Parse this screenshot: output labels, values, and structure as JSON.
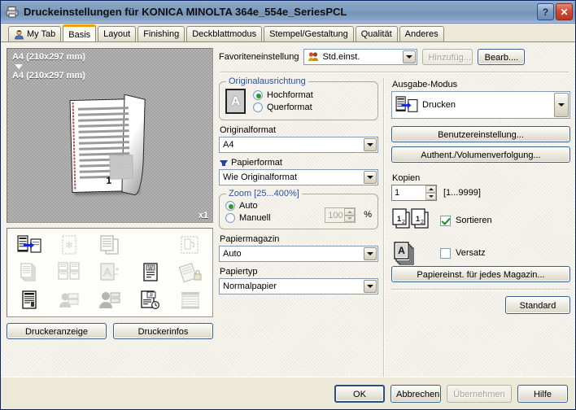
{
  "window": {
    "title": "Druckeinstellungen für KONICA MINOLTA 364e_554e_SeriesPCL",
    "icon": "printer-icon",
    "help_button": "?",
    "close_button": "✕"
  },
  "tabs": [
    {
      "label": "My Tab",
      "icon": "user-icon",
      "active": false
    },
    {
      "label": "Basis",
      "active": true
    },
    {
      "label": "Layout",
      "active": false
    },
    {
      "label": "Finishing",
      "active": false
    },
    {
      "label": "Deckblattmodus",
      "active": false
    },
    {
      "label": "Stempel/Gestaltung",
      "active": false
    },
    {
      "label": "Qualität",
      "active": false
    },
    {
      "label": "Anderes",
      "active": false
    }
  ],
  "preview": {
    "original_size": "A4 (210x297 mm)",
    "paper_size": "A4 (210x297 mm)",
    "zoom_indicator": "x1",
    "page_number": "1"
  },
  "icon_grid": [
    "printer-output-icon",
    "watermark-icon",
    "copy-pages-icon",
    "",
    "booklet-icon",
    "stacked-pages-icon",
    "nup-layout-icon",
    "overlay-a-icon",
    "form-overlay-icon",
    "secure-print-icon",
    "document-chart-icon",
    "user-box-icon",
    "user-auth-icon",
    "timed-print-icon",
    "blinds-icon"
  ],
  "preview_buttons": {
    "printer_display": "Druckeranzeige",
    "printer_info": "Druckerinfos"
  },
  "favorites": {
    "label": "Favoriteneinstellung",
    "value": "Std.einst.",
    "icon": "favorite-setting-icon",
    "add_button": "Hinzufüg....",
    "add_disabled": true,
    "edit_button": "Bearb...."
  },
  "orientation": {
    "group_label": "Originalausrichtung",
    "thumb_letter": "A",
    "options": [
      {
        "label": "Hochformat",
        "selected": true
      },
      {
        "label": "Querformat",
        "selected": false
      }
    ]
  },
  "original_format": {
    "label": "Originalformat",
    "value": "A4"
  },
  "paper_format": {
    "label": "Papierformat",
    "value": "Wie Originalformat",
    "arrow_icon": "down-arrow-icon"
  },
  "zoom": {
    "group_label": "Zoom [25...400%]",
    "options": [
      {
        "label": "Auto",
        "selected": true
      },
      {
        "label": "Manuell",
        "selected": false
      }
    ],
    "value": "100",
    "unit": "%",
    "disabled": true
  },
  "paper_tray": {
    "label": "Papiermagazin",
    "value": "Auto"
  },
  "paper_type": {
    "label": "Papiertyp",
    "value": "Normalpapier"
  },
  "output_mode": {
    "label": "Ausgabe-Modus",
    "value": "Drucken",
    "icon": "printer-output-icon"
  },
  "right_buttons": {
    "user_settings": "Benutzereinstellung...",
    "authentication": "Authent./Volumenverfolgung...",
    "tray_settings": "Papiereinst. für jedes Magazin...",
    "standard": "Standard"
  },
  "copies": {
    "label": "Kopien",
    "value": "1",
    "range": "[1...9999]"
  },
  "finishing": {
    "collate": {
      "label": "Sortieren",
      "checked": true,
      "icon": "collate-icon"
    },
    "offset": {
      "label": "Versatz",
      "checked": false,
      "icon": "offset-icon"
    }
  },
  "footer": {
    "ok": "OK",
    "cancel": "Abbrechen",
    "apply": "Übernehmen",
    "apply_disabled": true,
    "help": "Hilfe"
  },
  "colors": {
    "titlebar": "#7e9cbd",
    "accent_tab": "#f0a000",
    "group_label": "#2b52a8",
    "body_bg": "#f4f2ea",
    "arrow_blue": "#1d3fbe",
    "check_green": "#1d8a1d"
  }
}
